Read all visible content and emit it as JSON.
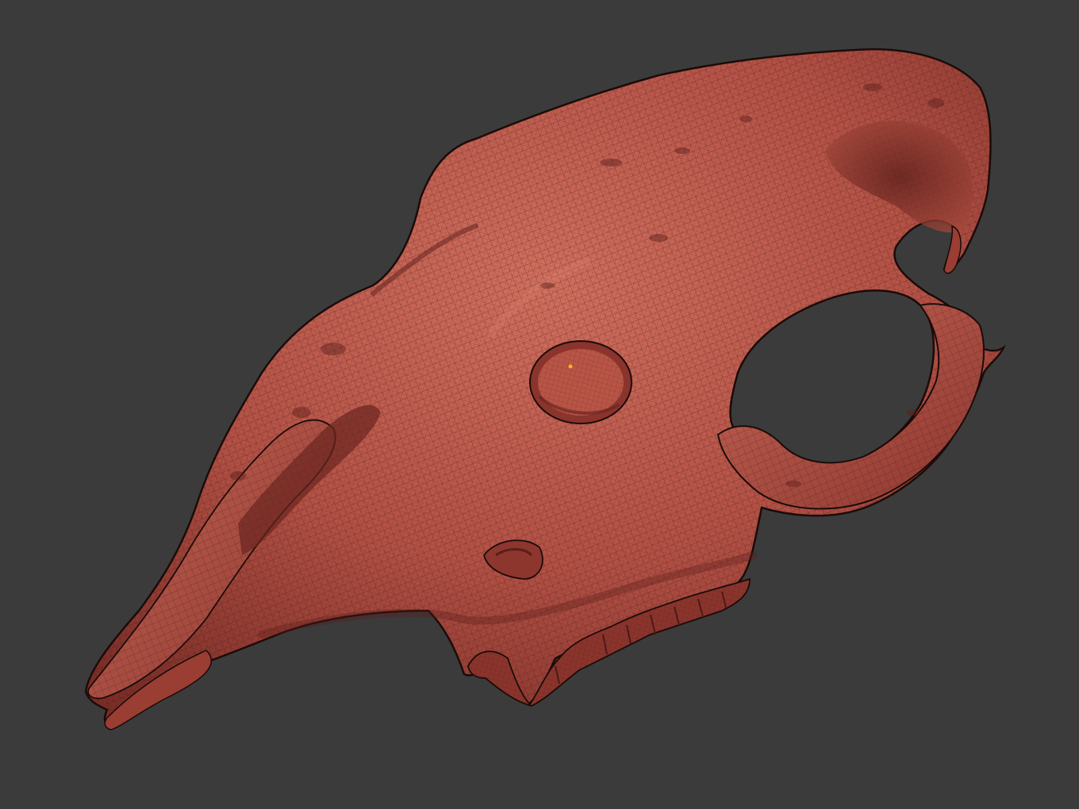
{
  "viewport": {
    "background_color": "#3b3b3b"
  },
  "model": {
    "subject": "animal-skull-wireframe-sculpt",
    "display_mode": "shaded-with-wireframe",
    "surface_color": "#b45145",
    "surface_highlight": "#d87565",
    "surface_shadow": "#6a2520",
    "wire_color": "#3a1714",
    "outline_color": "#1a0b09",
    "selection_marker_color": "#ffb020"
  }
}
